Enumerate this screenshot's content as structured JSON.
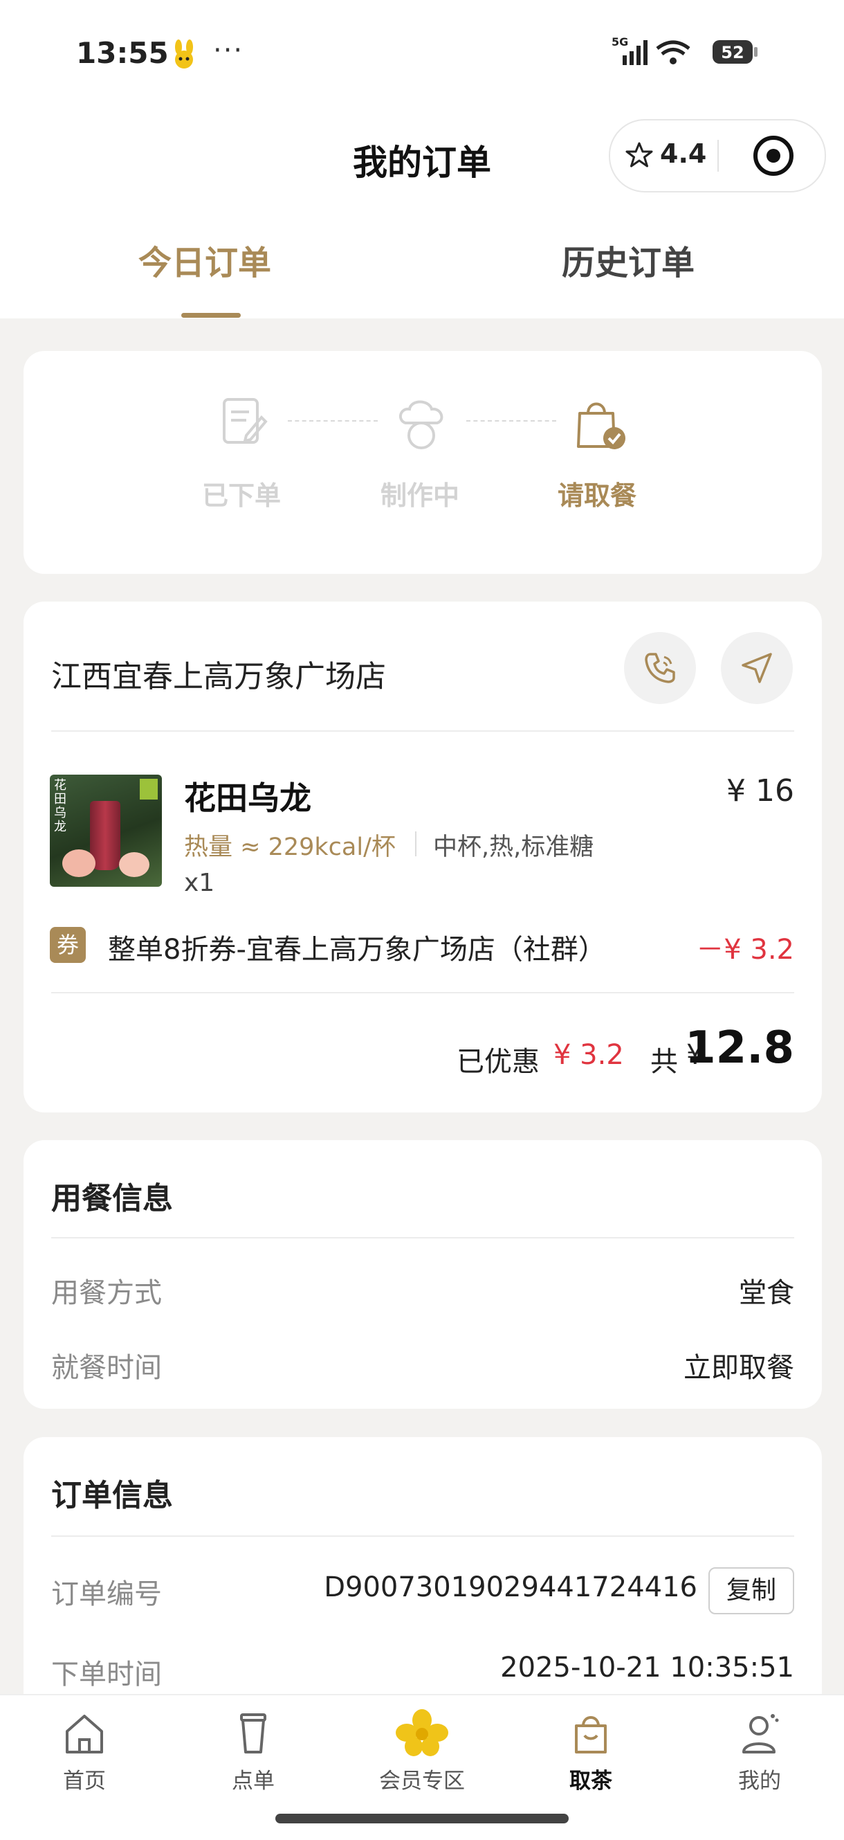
{
  "status_bar": {
    "time": "13:55",
    "more": "···",
    "network": "5G",
    "battery": "52"
  },
  "header": {
    "title": "我的订单",
    "rating": "4.4"
  },
  "tabs": [
    {
      "label": "今日订单",
      "active": true
    },
    {
      "label": "历史订单",
      "active": false
    }
  ],
  "progress": {
    "steps": [
      {
        "label": "已下单",
        "icon": "note-icon",
        "active": false
      },
      {
        "label": "制作中",
        "icon": "chef-icon",
        "active": false
      },
      {
        "label": "请取餐",
        "icon": "bag-check-icon",
        "active": true
      }
    ]
  },
  "order": {
    "store_name": "江西宜春上高万象广场店",
    "product": {
      "image_name": "花田乌龙",
      "name": "花田乌龙",
      "price": "¥ 16",
      "calories": "热量 ≈ 229kcal/杯",
      "spec": "中杯,热,标准糖",
      "qty": "x1"
    },
    "coupon": {
      "tag": "券",
      "text": "整单8折券-宜春上高万象广场店（社群）",
      "amount": "－¥ 3.2"
    },
    "summary": {
      "discount_label": "已优惠",
      "discount_value": "¥ 3.2",
      "total_label": "共",
      "currency": "¥",
      "total_value": "12.8"
    }
  },
  "dining_info": {
    "title": "用餐信息",
    "rows": [
      {
        "label": "用餐方式",
        "value": "堂食"
      },
      {
        "label": "就餐时间",
        "value": "立即取餐"
      }
    ]
  },
  "order_info": {
    "title": "订单信息",
    "order_no_label": "订单编号",
    "order_no": "D9007301902944172441​6",
    "copy_label": "复制",
    "time_label": "下单时间",
    "time_value": "2025-10-21 10:35:51"
  },
  "bottom_nav": [
    {
      "label": "首页",
      "icon": "home-icon",
      "active": false
    },
    {
      "label": "点单",
      "icon": "cup-icon",
      "active": false
    },
    {
      "label": "会员专区",
      "icon": "flower-icon",
      "active": false
    },
    {
      "label": "取茶",
      "icon": "bag-icon",
      "active": true
    },
    {
      "label": "我的",
      "icon": "profile-icon",
      "active": false
    }
  ],
  "colors": {
    "accent": "#a98a57",
    "red": "#e0343f",
    "background": "#f3f2f0"
  }
}
